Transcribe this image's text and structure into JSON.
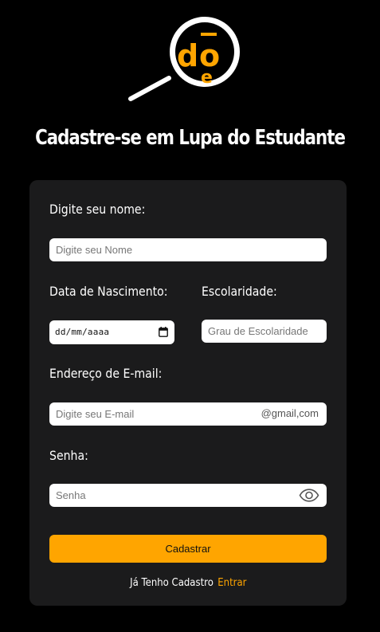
{
  "theme": {
    "background": "#000000",
    "card": "#1b1b1c",
    "accent": "#ffa500",
    "field_background": "#ffffff"
  },
  "logo": {
    "icon": "magnifier-logo-icon",
    "letters": [
      "d",
      "o",
      "e"
    ]
  },
  "page": {
    "title": "Cadastre-se em Lupa do Estudante"
  },
  "form": {
    "name": {
      "label": "Digite seu nome:",
      "placeholder": "Digite seu Nome"
    },
    "birth": {
      "label": "Data de Nascimento:",
      "value_display": "dd/mm/aaaa",
      "icon": "calendar-icon"
    },
    "schooling": {
      "label": "Escolaridade:",
      "placeholder": "Grau de Escolaridade"
    },
    "email": {
      "label": "Endereço de E-mail:",
      "placeholder": "Digite seu E-mail",
      "suffix": "@gmail,com"
    },
    "password": {
      "label": "Senha:",
      "placeholder": "Senha",
      "icon": "eye-icon"
    },
    "submit_label": "Cadastrar",
    "footer": {
      "text": "Já Tenho Cadastro",
      "link": "Entrar"
    }
  }
}
